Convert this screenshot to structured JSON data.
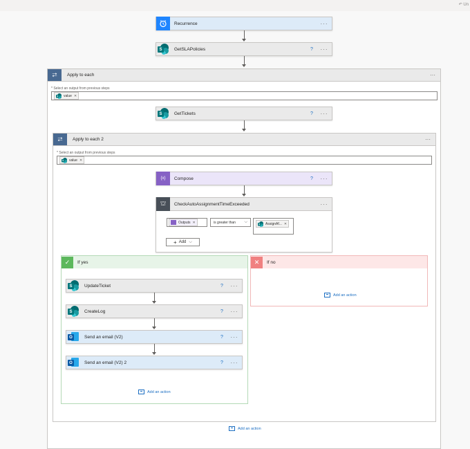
{
  "toolbar": {
    "undo_label": "Un"
  },
  "flow": {
    "recurrence": {
      "title": "Recurrence"
    },
    "get_sla": {
      "title": "GetSLAPolicies"
    },
    "apply_each": {
      "title": "Apply to each",
      "field_label": "* Select an output from previous steps",
      "token": "value",
      "get_tickets": {
        "title": "GetTickets"
      },
      "apply_each_2": {
        "title": "Apply to each 2",
        "field_label": "* Select an output from previous steps",
        "token": "value",
        "compose": {
          "title": "Compose"
        },
        "condition": {
          "title": "CheckAutoAssignmentTimeExceeded",
          "left_token": "Outputs",
          "operator": "is greater than",
          "right_token": "AssignAf...",
          "add_label": "Add"
        },
        "if_yes": {
          "title": "If yes",
          "actions": [
            {
              "title": "UpdateTicket",
              "icon": "sharepoint-icon"
            },
            {
              "title": "CreateLog",
              "icon": "sharepoint-icon"
            },
            {
              "title": "Send an email (V2)",
              "icon": "outlook-icon"
            },
            {
              "title": "Send an email (V2) 2",
              "icon": "outlook-icon"
            }
          ],
          "add_action": "Add an action"
        },
        "if_no": {
          "title": "If no",
          "add_action": "Add an action"
        }
      },
      "add_action": "Add an action"
    }
  },
  "icons": {
    "help": "?",
    "more": "···",
    "loop": "⮂",
    "check": "✓",
    "cross": "✕",
    "condition": "⛫",
    "compose": "{x}"
  },
  "colors": {
    "accent": "#1b6ec2",
    "loop": "#486991",
    "yes": "#5cb85c",
    "no": "#f08080",
    "compose": "#8661c5"
  }
}
